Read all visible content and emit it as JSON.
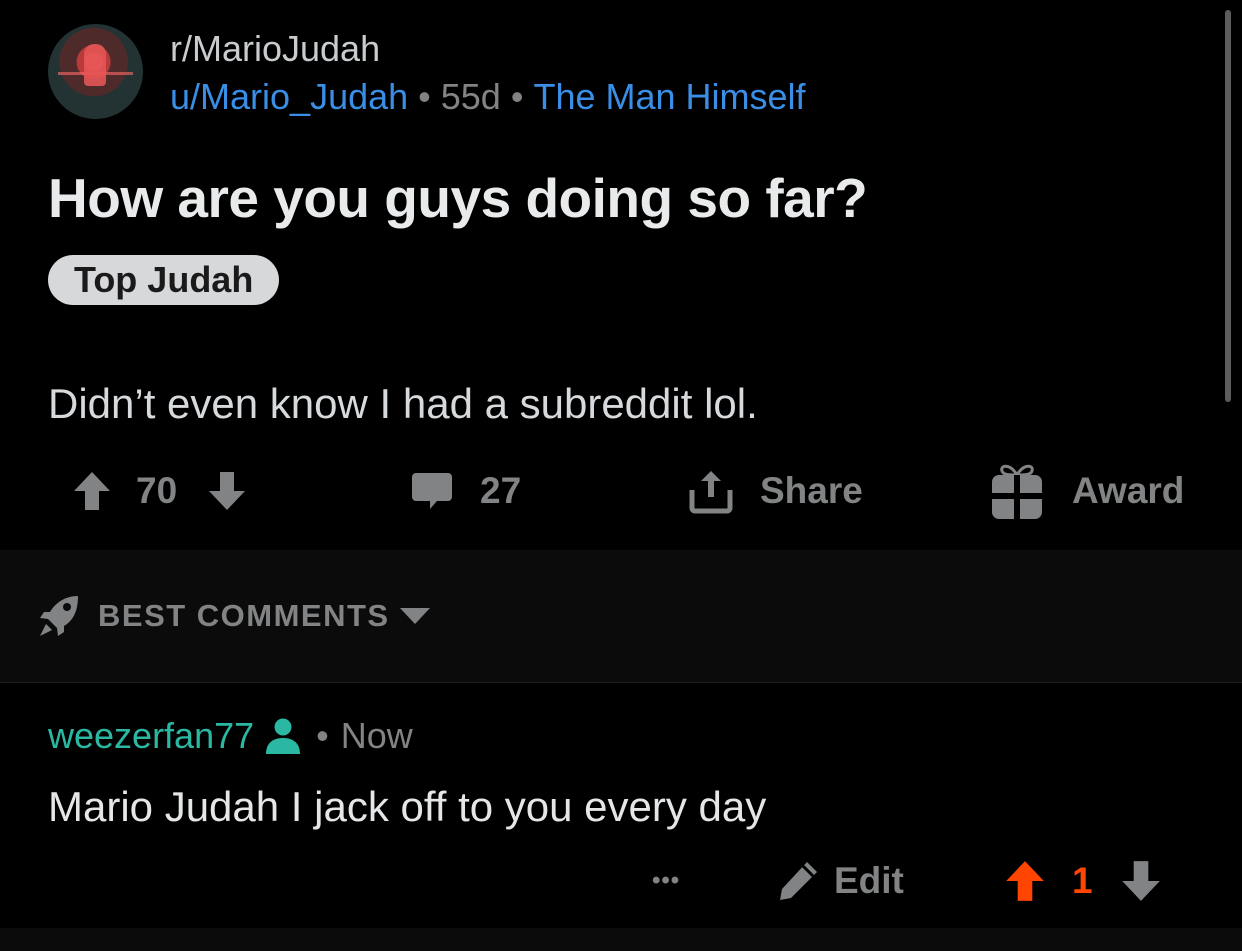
{
  "post": {
    "subreddit": "r/MarioJudah",
    "author": "u/Mario_Judah",
    "separator": "•",
    "age": "55d",
    "author_flair": "The Man Himself",
    "title": "How are you guys doing so far?",
    "post_flair": "Top Judah",
    "body": "Didn’t even know I had a subreddit lol.",
    "votes": "70",
    "comments": "27",
    "share_label": "Share",
    "award_label": "Award"
  },
  "sort": {
    "label": "BEST COMMENTS"
  },
  "comment": {
    "user": "weezerfan77",
    "separator": "•",
    "time": "Now",
    "text": "Mario Judah I jack off to you every day",
    "more": "•••",
    "edit_label": "Edit",
    "votes": "1"
  },
  "colors": {
    "background": "#000000",
    "link_blue": "#3a8ee6",
    "username_teal": "#2ab8a2",
    "upvote_orange": "#ff4500",
    "muted_gray": "#818384"
  }
}
